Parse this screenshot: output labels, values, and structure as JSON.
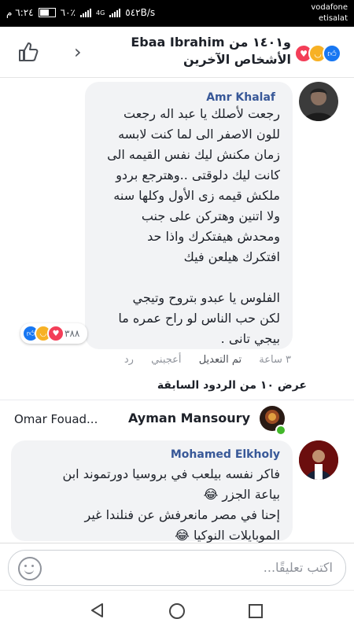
{
  "status_bar": {
    "time": "٦:٢٤ م",
    "battery": "٦٠٪",
    "battery_level": 0.6,
    "network": "4G",
    "speed": "٥٤٢B/s",
    "carrier_1": "vodafone",
    "carrier_2": "etisalat"
  },
  "header": {
    "title_name": "Ebaa Ibrahim",
    "title_suffix": "و١٤٠١ من",
    "subtitle": "الأشخاص الآخرين",
    "reactions": [
      "like-icon",
      "haha-icon",
      "love-icon"
    ]
  },
  "comments": [
    {
      "author": "Amr Khalaf",
      "text": "رجعت لأصلك يا عبد اله رجعت\nللون الاصفر الى لما كنت لابسه\nزمان  مكنش ليك نفس القيمه الى\nكانت ليك دلوقتى  ..وهترجع بردو\nملكش قيمه زى الأول  وكلها سنه\nولا اتنين وهتركن على جنب\nومحدش هيفتكرك واذا حد\nافتكرك هيلعن فيك\n\nالفلوس يا عبدو بتروح وتيجي\nلكن حب الناس لو راح عمره ما\nبيجي تانى .",
      "reaction_count": "٣٨٨",
      "time": "٣ ساعة",
      "edited": "تم التعديل",
      "like": "أعجبني",
      "reply": "رد"
    },
    {
      "author": "Mohamed Elkholy",
      "text": "فاكر نفسه بيلعب في بروسيا دورتموند ابن\nبياعة الجزر 😂\nإحنا في مصر مانعرفش عن فنلندا غير\nالموبايلات النوكيا 😂"
    }
  ],
  "previous_replies": "عرض ١٠ من الردود السابقة",
  "typing": {
    "active_user": "Ayman Mansoury",
    "other_user": "Omar Fouad..."
  },
  "composer": {
    "placeholder": "اكتب تعليقًا..."
  },
  "colors": {
    "accent": "#385898",
    "like_blue": "#1877f2",
    "bubble_bg": "#f2f3f5",
    "online_green": "#42b72a"
  }
}
